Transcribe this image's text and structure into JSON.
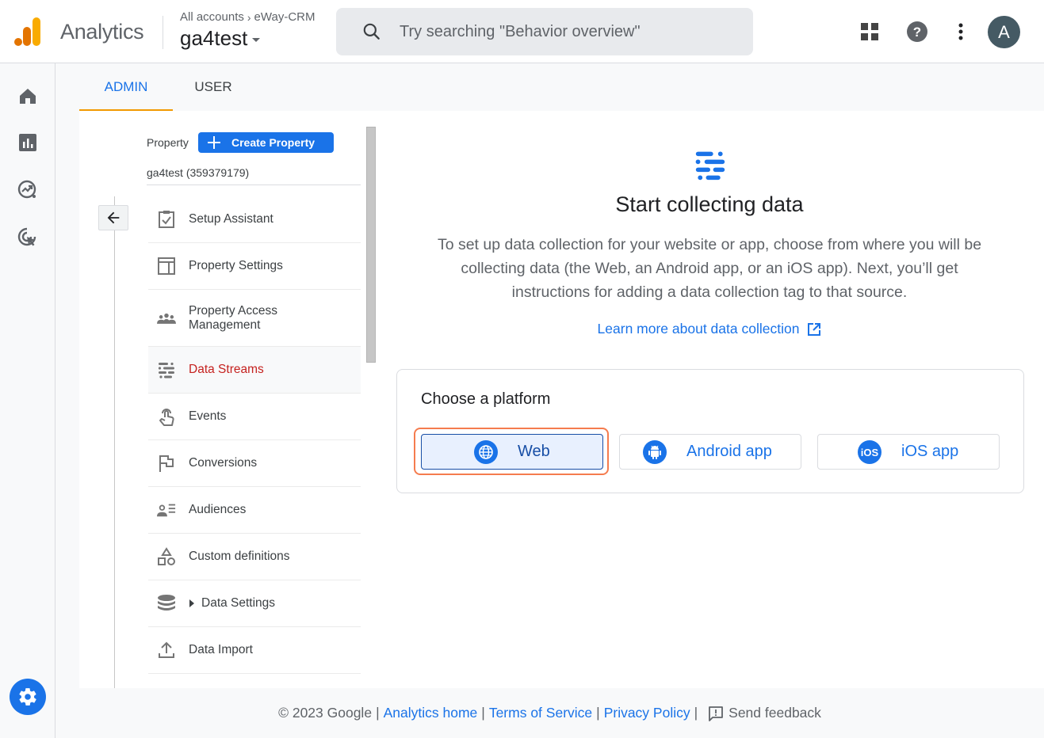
{
  "header": {
    "app_name": "Analytics",
    "breadcrumb": {
      "parent": "All accounts",
      "account": "eWay-CRM"
    },
    "property_name": "ga4test",
    "search_placeholder": "Try searching \"Behavior overview\"",
    "icons": [
      "apps-grid-icon",
      "help-icon",
      "more-vert-icon"
    ],
    "avatar_initial": "A"
  },
  "rail": {
    "items": [
      "home-icon",
      "reports-icon",
      "explore-icon",
      "advertising-icon"
    ],
    "settings": "admin-gear-icon"
  },
  "tabs": [
    {
      "label": "ADMIN",
      "active": true
    },
    {
      "label": "USER",
      "active": false
    }
  ],
  "property_column": {
    "label": "Property",
    "create_button": "Create Property",
    "selected_property": "ga4test (359379179)",
    "menu": [
      {
        "label": "Setup Assistant",
        "icon": "clipboard-check-icon"
      },
      {
        "label": "Property Settings",
        "icon": "property-settings-icon"
      },
      {
        "label": "Property Access Management",
        "icon": "people-icon"
      },
      {
        "label": "Data Streams",
        "icon": "data-streams-icon",
        "active": true
      },
      {
        "label": "Events",
        "icon": "touch-icon"
      },
      {
        "label": "Conversions",
        "icon": "flag-icon"
      },
      {
        "label": "Audiences",
        "icon": "audience-icon"
      },
      {
        "label": "Custom definitions",
        "icon": "shapes-icon"
      },
      {
        "label": "Data Settings",
        "icon": "database-icon",
        "expandable": true
      },
      {
        "label": "Data Import",
        "icon": "upload-icon"
      }
    ]
  },
  "main": {
    "title": "Start collecting data",
    "description": "To set up data collection for your website or app, choose from where you will be collecting data (the Web, an Android app, or an iOS app). Next, you’ll get instructions for adding a data collection tag to that source.",
    "learn_more": "Learn more about data collection",
    "platform_title": "Choose a platform",
    "platforms": [
      {
        "label": "Web",
        "icon": "globe-icon",
        "selected": true
      },
      {
        "label": "Android app",
        "icon": "android-icon"
      },
      {
        "label": "iOS app",
        "icon": "ios-icon"
      }
    ]
  },
  "footer": {
    "copyright": "© 2023 Google",
    "links": [
      "Analytics home",
      "Terms of Service",
      "Privacy Policy"
    ],
    "feedback": "Send feedback"
  },
  "colors": {
    "accent": "#1a73e8",
    "tab_indicator": "#f29900",
    "active_menu_text": "#c5221f",
    "highlight_ring": "#f57c4e"
  }
}
